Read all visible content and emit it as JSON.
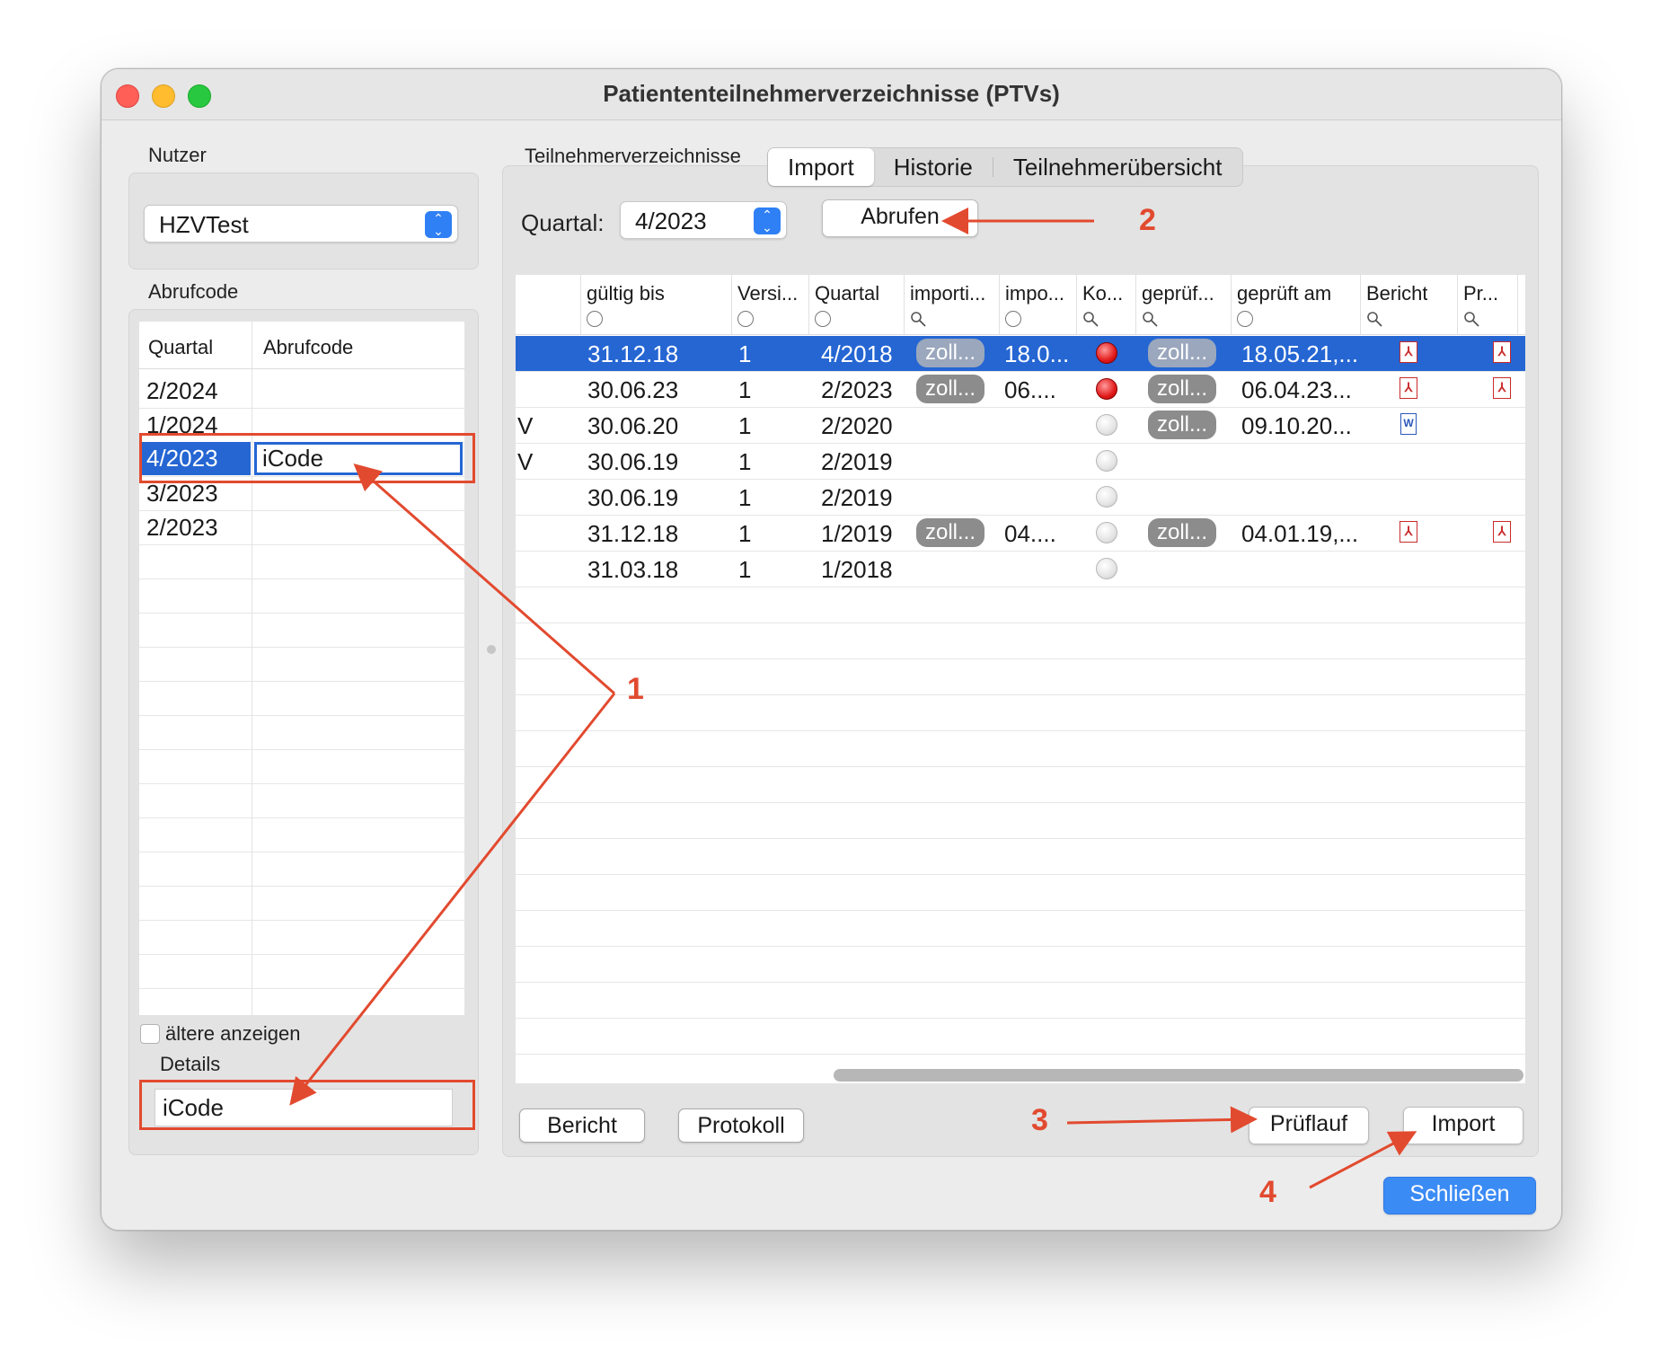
{
  "window": {
    "title": "Patiententeilnehmerverzeichnisse (PTVs)"
  },
  "left": {
    "nutzer_label": "Nutzer",
    "nutzer_value": "HZVTest",
    "abrufcode_label": "Abrufcode",
    "table_headers": [
      "Quartal",
      "Abrufcode"
    ],
    "rows": [
      {
        "quartal": "2/2024",
        "code": ""
      },
      {
        "quartal": "1/2024",
        "code": ""
      },
      {
        "quartal": "4/2023",
        "code": "iCode"
      },
      {
        "quartal": "3/2023",
        "code": ""
      },
      {
        "quartal": "2/2023",
        "code": ""
      }
    ],
    "older_label": "ältere anzeigen",
    "details_label": "Details",
    "details_value": "iCode"
  },
  "right": {
    "section_label": "Teilnehmerverzeichnisse",
    "tabs": [
      "Import",
      "Historie",
      "Teilnehmerübersicht"
    ],
    "quartal_label": "Quartal:",
    "quartal_value": "4/2023",
    "abrufen_label": "Abrufen",
    "columns": [
      "gültig bis",
      "Versi...",
      "Quartal",
      "importi...",
      "impo...",
      "Ko...",
      "geprüf...",
      "geprüft am",
      "Bericht",
      "Pr..."
    ],
    "rows": [
      {
        "flag": "",
        "gueltig": "31.12.18",
        "version": "1",
        "quartal": "4/2018",
        "importiert": "zoll...",
        "impo": "18.0...",
        "status": "red",
        "geprueft": "zoll...",
        "geprueft_am": "18.05.21,...",
        "bericht": "pdf",
        "pr": "pdf"
      },
      {
        "flag": "",
        "gueltig": "30.06.23",
        "version": "1",
        "quartal": "2/2023",
        "importiert": "zoll...",
        "impo": "06....",
        "status": "red",
        "geprueft": "zoll...",
        "geprueft_am": "06.04.23...",
        "bericht": "pdf",
        "pr": "pdf"
      },
      {
        "flag": "V",
        "gueltig": "30.06.20",
        "version": "1",
        "quartal": "2/2020",
        "importiert": "",
        "impo": "",
        "status": "grey",
        "geprueft": "zoll...",
        "geprueft_am": "09.10.20...",
        "bericht": "doc",
        "pr": ""
      },
      {
        "flag": "V",
        "gueltig": "30.06.19",
        "version": "1",
        "quartal": "2/2019",
        "importiert": "",
        "impo": "",
        "status": "grey",
        "geprueft": "",
        "geprueft_am": "",
        "bericht": "",
        "pr": ""
      },
      {
        "flag": "",
        "gueltig": "30.06.19",
        "version": "1",
        "quartal": "2/2019",
        "importiert": "",
        "impo": "",
        "status": "grey",
        "geprueft": "",
        "geprueft_am": "",
        "bericht": "",
        "pr": ""
      },
      {
        "flag": "",
        "gueltig": "31.12.18",
        "version": "1",
        "quartal": "1/2019",
        "importiert": "zoll...",
        "impo": "04....",
        "status": "grey",
        "geprueft": "zoll...",
        "geprueft_am": "04.01.19,...",
        "bericht": "pdf",
        "pr": "pdf"
      },
      {
        "flag": "",
        "gueltig": "31.03.18",
        "version": "1",
        "quartal": "1/2018",
        "importiert": "",
        "impo": "",
        "status": "grey",
        "geprueft": "",
        "geprueft_am": "",
        "bericht": "",
        "pr": ""
      }
    ],
    "bericht_button": "Bericht",
    "protokoll_button": "Protokoll",
    "prueflauf_button": "Prüflauf",
    "import_button": "Import"
  },
  "schliessen_button": "Schließen",
  "annotations": {
    "a1": "1",
    "a2": "2",
    "a3": "3",
    "a4": "4",
    "color": "#e24a2f"
  },
  "colors": {
    "selection": "#2566d3",
    "accent": "#3b8bf5"
  }
}
